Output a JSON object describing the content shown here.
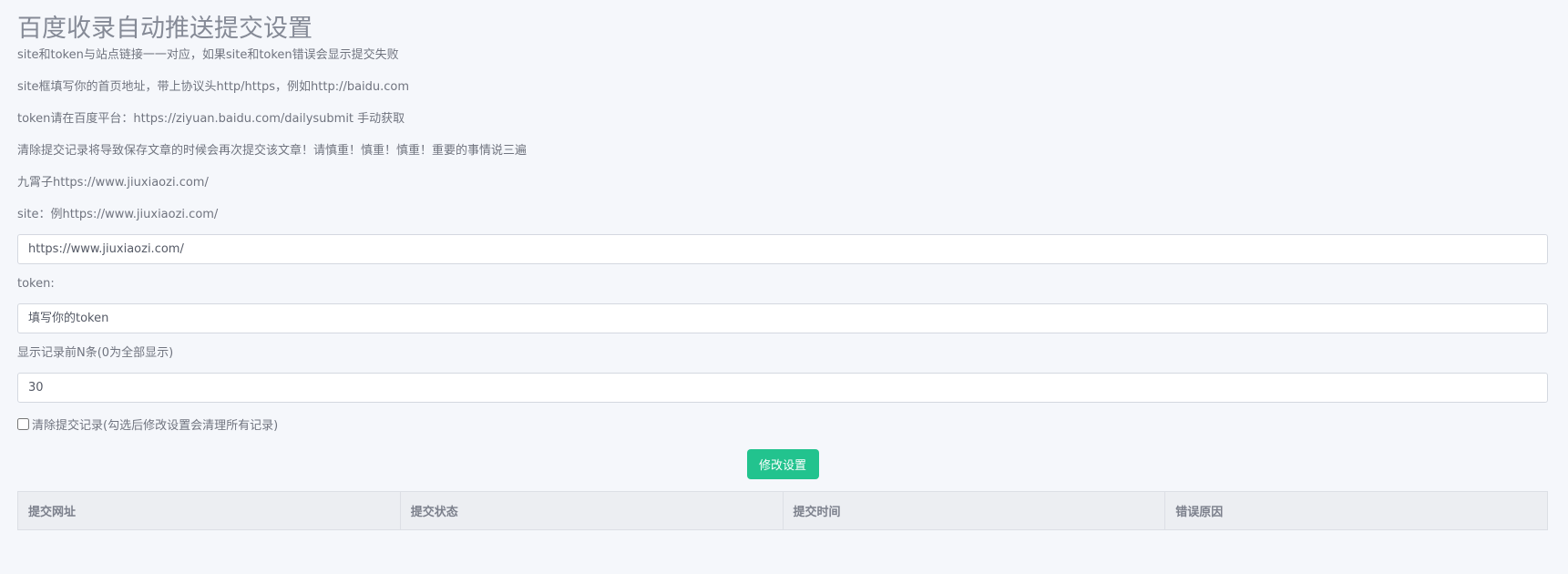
{
  "page": {
    "title": "百度收录自动推送提交设置"
  },
  "notes": [
    "site和token与站点链接一一对应，如果site和token错误会显示提交失败",
    "site框填写你的首页地址，带上协议头http/https，例如http://baidu.com",
    "token请在百度平台：https://ziyuan.baidu.com/dailysubmit 手动获取",
    "清除提交记录将导致保存文章的时候会再次提交该文章！请慎重！慎重！慎重！重要的事情说三遍",
    "九霄子https://www.jiuxiaozi.com/"
  ],
  "form": {
    "site_label": "site：例https://www.jiuxiaozi.com/",
    "site_value": "https://www.jiuxiaozi.com/",
    "token_label": "token:",
    "token_placeholder": "填写你的token",
    "count_label": "显示记录前N条(0为全部显示)",
    "count_value": "30",
    "clear_label": "清除提交记录(勾选后修改设置会清理所有记录)",
    "clear_checked": false,
    "submit_label": "修改设置"
  },
  "table": {
    "columns": [
      "提交网址",
      "提交状态",
      "提交时间",
      "错误原因"
    ],
    "rows": []
  },
  "colors": {
    "accent": "#22c38e",
    "background": "#f5f7fb",
    "table_header": "#eceef2"
  }
}
